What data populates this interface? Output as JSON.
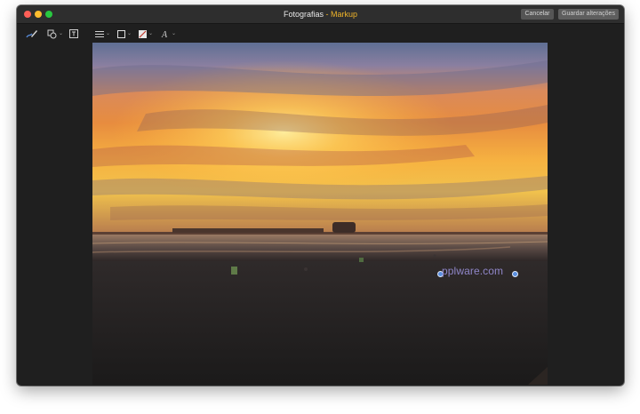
{
  "window": {
    "title_doc": "Fotografias",
    "title_sep": " - ",
    "title_app": "Markup"
  },
  "buttons": {
    "cancel": "Cancelar",
    "save": "Guardar alterações"
  },
  "toolbar": {
    "tools": [
      {
        "name": "sketch-tool",
        "icon": "pen-icon"
      },
      {
        "name": "shapes-tool",
        "icon": "shapes-icon",
        "has_menu": true
      },
      {
        "name": "text-tool",
        "icon": "text-box-icon"
      },
      {
        "name": "line-style-tool",
        "icon": "lines-icon",
        "has_menu": true
      },
      {
        "name": "border-color-tool",
        "icon": "square-outline-icon",
        "has_menu": true
      },
      {
        "name": "fill-color-tool",
        "icon": "fill-square-icon",
        "has_menu": true
      },
      {
        "name": "text-style-tool",
        "icon": "font-a-icon",
        "has_menu": true
      }
    ],
    "chevron": "⌄"
  },
  "photo": {
    "watermark_text": "pplware.com",
    "watermark_color": "#8f86c9"
  },
  "colors": {
    "window_bg": "#1f1f1f",
    "titlebar_bg": "#2e2e2e",
    "accent": "#f0b429",
    "handle": "#5a8fe0"
  }
}
